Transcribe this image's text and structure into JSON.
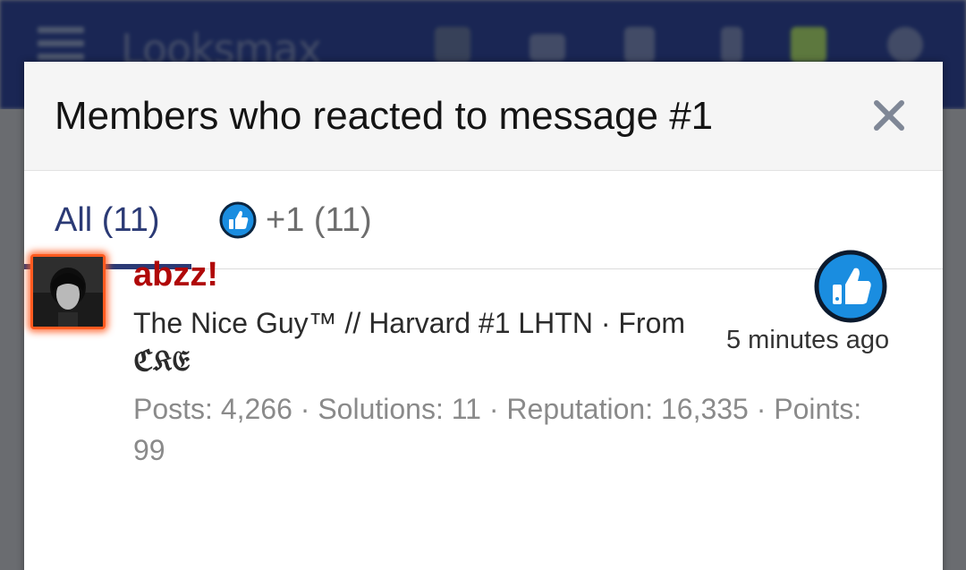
{
  "background": {
    "site_name": "Looksmax"
  },
  "dialog": {
    "title": "Members who reacted to message #1",
    "close_label": "×"
  },
  "tabs": [
    {
      "label": "All (11)",
      "active": true
    },
    {
      "label": "+1 (11)",
      "icon": "thumbs-up-icon",
      "active": false
    }
  ],
  "members": [
    {
      "name": "abzz!",
      "title_line": "The Nice Guy™ // Harvard #1 LHTN · From",
      "title_tag": "ℭ𝔎𝔈",
      "stats": "Posts: 4,266 · Solutions: 11 · Reputation: 16,335 · Points: 99",
      "reaction_icon": "thumbs-up-icon",
      "reaction_time": "5 minutes ago"
    }
  ],
  "colors": {
    "header_bg": "#0c1a4f",
    "accent": "#2b3a75",
    "username": "#b00808",
    "avatar_glow": "#ff5a1f",
    "like_blue": "#1a8de0"
  }
}
